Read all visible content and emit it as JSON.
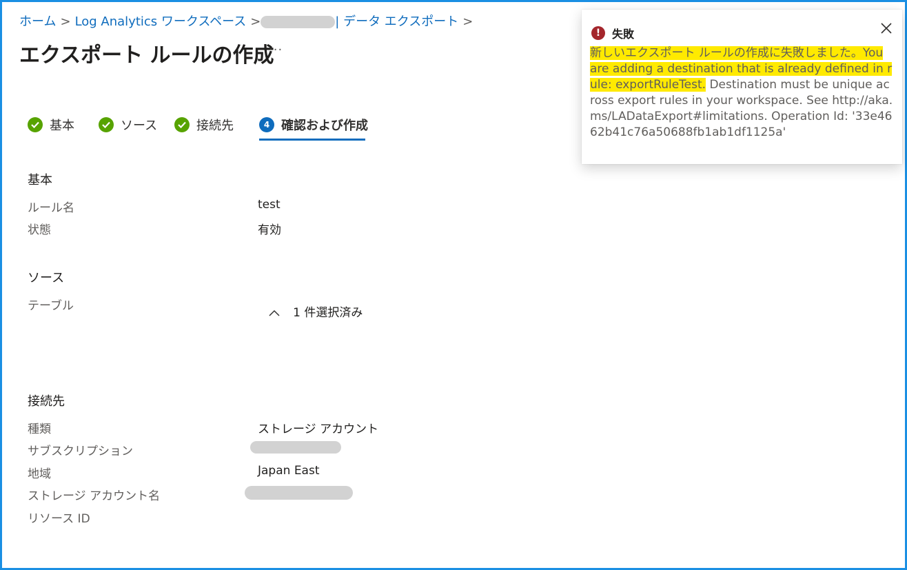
{
  "breadcrumb": {
    "home": "ホーム",
    "workspaces": "Log Analytics ワークスペース",
    "current": "| データ エクスポート"
  },
  "page": {
    "title": "エクスポート ルールの作成",
    "more": "···"
  },
  "steps": [
    {
      "label": "基本",
      "status": "done"
    },
    {
      "label": "ソース",
      "status": "done"
    },
    {
      "label": "接続先",
      "status": "done"
    },
    {
      "label": "確認および作成",
      "status": "active",
      "number": "4"
    }
  ],
  "basics": {
    "section": "基本",
    "rule_name_label": "ルール名",
    "rule_name_value": "test",
    "state_label": "状態",
    "state_value": "有効"
  },
  "source": {
    "section": "ソース",
    "table_label": "テーブル",
    "table_value": "1 件選択済み"
  },
  "destination": {
    "section": "接続先",
    "type_label": "種類",
    "type_value": "ストレージ アカウント",
    "subscription_label": "サブスクリプション",
    "region_label": "地域",
    "region_value": "Japan East",
    "storage_label": "ストレージ アカウント名",
    "resource_id_label": "リソース ID"
  },
  "toast": {
    "title": "失敗",
    "message_highlight": "新しいエクスポート ルールの作成に失敗しました。You are adding a destination that is already defined in rule: exportRuleTest.",
    "message_rest": " Destination must be unique across export rules in your workspace. See http://aka.ms/LADataExport#limitations. Operation Id: '33e4662b41c76a50688fb1ab1df1125a'",
    "close_icon": "close-icon",
    "error_icon": "error-icon"
  },
  "colors": {
    "accent": "#0f6cbd",
    "success": "#57a300",
    "error": "#a4262c",
    "highlight": "#ffea00"
  }
}
